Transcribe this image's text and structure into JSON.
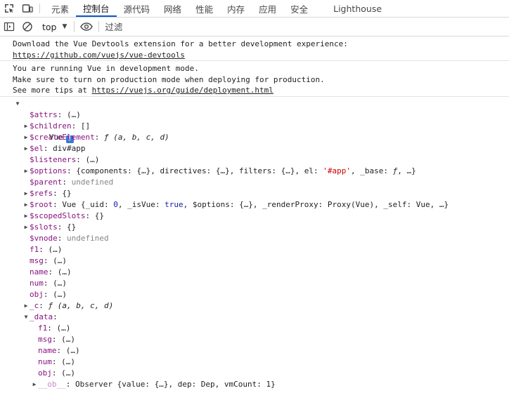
{
  "tabs": [
    "元素",
    "控制台",
    "源代码",
    "网络",
    "性能",
    "内存",
    "应用",
    "安全",
    "Lighthouse"
  ],
  "active_tab": "控制台",
  "toolbar": {
    "context": "top",
    "filter_placeholder": "过滤"
  },
  "messages": [
    {
      "lines": [
        "Download the Vue Devtools extension for a better development experience:"
      ],
      "link": "https://github.com/vuejs/vue-devtools"
    },
    {
      "lines": [
        "You are running Vue in development mode.",
        "Make sure to turn on production mode when deploying for production."
      ],
      "tip_prefix": "See more tips at ",
      "link": "https://vuejs.org/guide/deployment.html"
    }
  ],
  "tree": {
    "root_label": "Vue",
    "info_glyph": "i",
    "rows": [
      {
        "expander": "none",
        "depth": 1,
        "key": "$attrs",
        "value": "(…)",
        "vtype": "lazy"
      },
      {
        "expander": "closed",
        "depth": 1,
        "key": "$children",
        "value": "[]",
        "vtype": "plain"
      },
      {
        "expander": "closed",
        "depth": 1,
        "key": "$createElement",
        "value": "ƒ (a, b, c, d)",
        "vtype": "fn"
      },
      {
        "expander": "closed",
        "depth": 1,
        "key": "$el",
        "value": "div#app",
        "vtype": "plain"
      },
      {
        "expander": "none",
        "depth": 1,
        "key": "$listeners",
        "value": "(…)",
        "vtype": "lazy"
      },
      {
        "expander": "closed",
        "depth": 1,
        "key": "$options",
        "value": "{components: {…}, directives: {…}, filters: {…}, el: '#app', _base: ƒ, …}",
        "vtype": "options"
      },
      {
        "expander": "none",
        "depth": 1,
        "key": "$parent",
        "value": "undefined",
        "vtype": "undef"
      },
      {
        "expander": "closed",
        "depth": 1,
        "key": "$refs",
        "value": "{}",
        "vtype": "plain"
      },
      {
        "expander": "closed",
        "depth": 1,
        "key": "$root",
        "value": "Vue {_uid: 0, _isVue: true, $options: {…}, _renderProxy: Proxy(Vue), _self: Vue, …}",
        "vtype": "root"
      },
      {
        "expander": "closed",
        "depth": 1,
        "key": "$scopedSlots",
        "value": "{}",
        "vtype": "plain"
      },
      {
        "expander": "closed",
        "depth": 1,
        "key": "$slots",
        "value": "{}",
        "vtype": "plain"
      },
      {
        "expander": "none",
        "depth": 1,
        "key": "$vnode",
        "value": "undefined",
        "vtype": "undef"
      },
      {
        "expander": "none",
        "depth": 1,
        "key": "f1",
        "value": "(…)",
        "vtype": "lazy"
      },
      {
        "expander": "none",
        "depth": 1,
        "key": "msg",
        "value": "(…)",
        "vtype": "lazy"
      },
      {
        "expander": "none",
        "depth": 1,
        "key": "name",
        "value": "(…)",
        "vtype": "lazy"
      },
      {
        "expander": "none",
        "depth": 1,
        "key": "num",
        "value": "(…)",
        "vtype": "lazy"
      },
      {
        "expander": "none",
        "depth": 1,
        "key": "obj",
        "value": "(…)",
        "vtype": "lazy"
      },
      {
        "expander": "closed",
        "depth": 1,
        "key": "_c",
        "value": "ƒ (a, b, c, d)",
        "vtype": "fn"
      },
      {
        "expander": "open",
        "depth": 1,
        "key": "_data",
        "value": "",
        "vtype": "plain"
      },
      {
        "expander": "none",
        "depth": 2,
        "key": "f1",
        "value": "(…)",
        "vtype": "lazy"
      },
      {
        "expander": "none",
        "depth": 2,
        "key": "msg",
        "value": "(…)",
        "vtype": "lazy"
      },
      {
        "expander": "none",
        "depth": 2,
        "key": "name",
        "value": "(…)",
        "vtype": "lazy"
      },
      {
        "expander": "none",
        "depth": 2,
        "key": "num",
        "value": "(…)",
        "vtype": "lazy"
      },
      {
        "expander": "none",
        "depth": 2,
        "key": "obj",
        "value": "(…)",
        "vtype": "lazy"
      },
      {
        "expander": "closed",
        "depth": 2,
        "key": "__ob__",
        "value": "Observer {value: {…}, dep: Dep, vmCount: 1}",
        "vtype": "plain",
        "dim": true
      }
    ]
  }
}
